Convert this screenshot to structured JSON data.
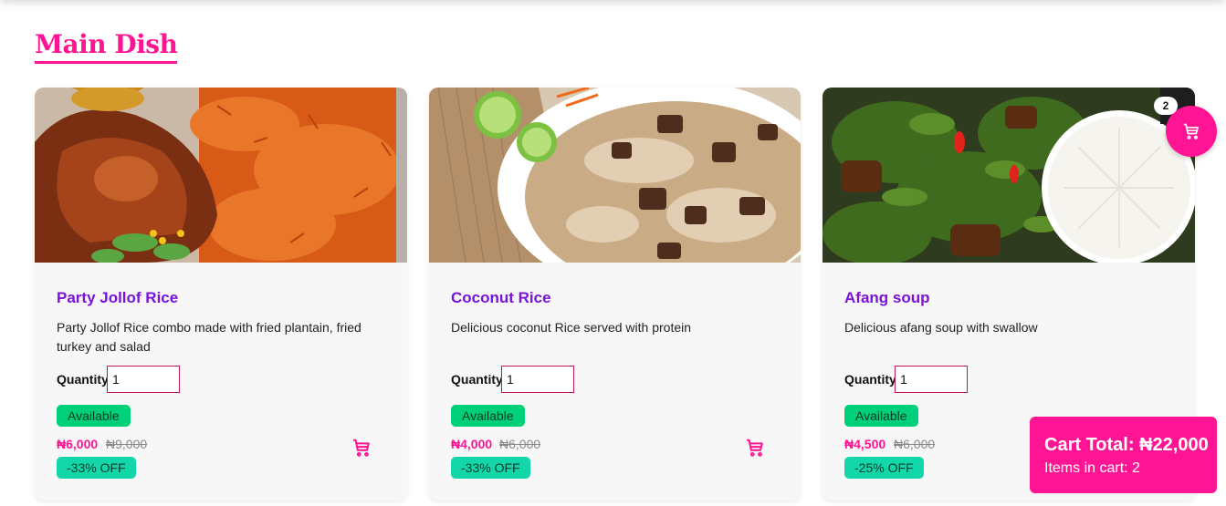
{
  "section": {
    "title": "Main Dish"
  },
  "products": [
    {
      "name": "Party Jollof Rice",
      "description": "Party Jollof Rice combo made with fried plantain, fried turkey and salad",
      "quantity_label": "Quantity",
      "quantity_value": "1",
      "availability": "Available",
      "price": "₦6,000",
      "old_price": "₦9,000",
      "discount": "-33% OFF",
      "image_icon": "jollof-rice-photo"
    },
    {
      "name": "Coconut Rice",
      "description": "Delicious coconut Rice served with protein",
      "quantity_label": "Quantity",
      "quantity_value": "1",
      "availability": "Available",
      "price": "₦4,000",
      "old_price": "₦6,000",
      "discount": "-33% OFF",
      "image_icon": "coconut-rice-photo"
    },
    {
      "name": "Afang soup",
      "description": "Delicious afang soup with swallow",
      "quantity_label": "Quantity",
      "quantity_value": "1",
      "availability": "Available",
      "price": "₦4,500",
      "old_price": "₦6,000",
      "discount": "-25% OFF",
      "image_icon": "afang-soup-photo"
    }
  ],
  "floating_cart": {
    "count": "2",
    "icon": "cart-icon"
  },
  "cart_summary": {
    "total": "Cart Total: ₦22,000",
    "items": "Items in cart: 2"
  },
  "colors": {
    "accent": "#ff1493",
    "title_purple": "#7a12d9",
    "available_green": "#00d07a",
    "discount_teal": "#13d7a8"
  }
}
